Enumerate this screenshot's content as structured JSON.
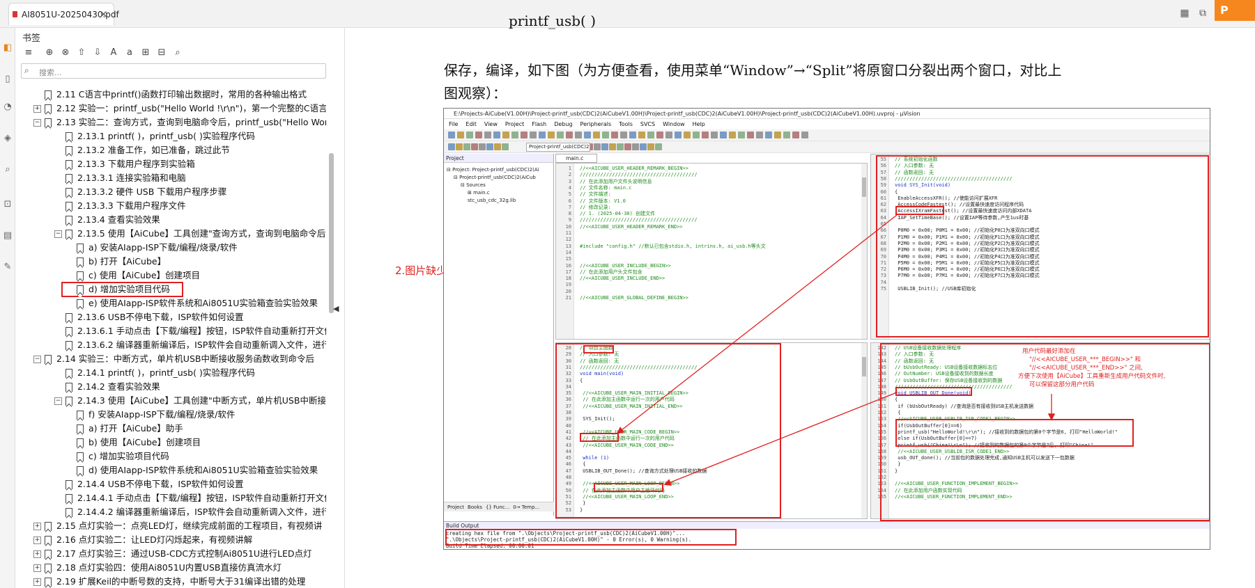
{
  "tab": {
    "filename": "AI8051U-20250430.pdf",
    "close": "×"
  },
  "brand": "P",
  "bookmarks": {
    "title": "书签",
    "search_placeholder": "搜索...",
    "items": [
      {
        "level": 1,
        "exp": "none",
        "text": "2.11 C语言中printf()函数打印输出数据时，常用的各种输出格式"
      },
      {
        "level": 1,
        "exp": "+",
        "text": "2.12 实验一：printf_usb(\"Hello World !\\r\\n\")，第一个完整的C语言程"
      },
      {
        "level": 1,
        "exp": "-",
        "text": "2.13 实验二：查询方式，查询到电脑命令后，printf_usb(\"Hello Wor"
      },
      {
        "level": 2,
        "exp": "none",
        "text": "2.13.1 printf( )，printf_usb( )实验程序代码"
      },
      {
        "level": 2,
        "exp": "none",
        "text": "2.13.2 准备工作，如已准备，跳过此节"
      },
      {
        "level": 2,
        "exp": "none",
        "text": "2.13.3 下载用户程序到实验箱"
      },
      {
        "level": 2,
        "exp": "none",
        "text": "2.13.3.1 连接实验箱和电脑"
      },
      {
        "level": 2,
        "exp": "none",
        "text": "2.13.3.2 硬件 USB 下载用户程序步骤"
      },
      {
        "level": 2,
        "exp": "none",
        "text": "2.13.3.3 下载用户程序文件"
      },
      {
        "level": 2,
        "exp": "none",
        "text": "2.13.4 查看实验效果"
      },
      {
        "level": 2,
        "exp": "-",
        "text": "2.13.5 使用【AiCube】工具创建\"查询方式，查询到电脑命令后,"
      },
      {
        "level": 3,
        "exp": "none",
        "text": "a) 安装AIapp-ISP下载/编程/烧录/软件"
      },
      {
        "level": 3,
        "exp": "none",
        "text": "b) 打开【AiCube】"
      },
      {
        "level": 3,
        "exp": "none",
        "text": "c) 使用【AiCube】创建项目"
      },
      {
        "level": 3,
        "exp": "none",
        "text": "d) 增加实验项目代码",
        "selected": true
      },
      {
        "level": 3,
        "exp": "none",
        "text": "e) 使用AIapp-ISP软件系统和Ai8051U实验箱查验实验效果"
      },
      {
        "level": 2,
        "exp": "none",
        "text": "2.13.6 USB不停电下载，ISP软件如何设置"
      },
      {
        "level": 2,
        "exp": "none",
        "text": "2.13.6.1 手动点击【下载/编程】按钮，ISP软件自动重新打开文件"
      },
      {
        "level": 2,
        "exp": "none",
        "text": "2.13.6.2 编译器重新编译后，ISP软件会自动重新调入文件，进行"
      },
      {
        "level": 1,
        "exp": "-",
        "text": "2.14 实验三：中断方式，单片机USB中断接收服务函数收到命令后"
      },
      {
        "level": 2,
        "exp": "none",
        "text": "2.14.1 printf( )，printf_usb( )实验程序代码"
      },
      {
        "level": 2,
        "exp": "none",
        "text": "2.14.2 查看实验效果"
      },
      {
        "level": 2,
        "exp": "-",
        "text": "2.14.3 使用【AiCube】工具创建\"中断方式，单片机USB中断接收"
      },
      {
        "level": 3,
        "exp": "none",
        "text": "f) 安装AIapp-ISP下载/编程/烧录/软件"
      },
      {
        "level": 3,
        "exp": "none",
        "text": "a) 打开【AiCube】助手"
      },
      {
        "level": 3,
        "exp": "none",
        "text": "b) 使用【AiCube】创建项目"
      },
      {
        "level": 3,
        "exp": "none",
        "text": "c) 增加实验项目代码"
      },
      {
        "level": 3,
        "exp": "none",
        "text": "d) 使用AIapp-ISP软件系统和Ai8051U实验箱查验实验效果"
      },
      {
        "level": 2,
        "exp": "none",
        "text": "2.14.4 USB不停电下载，ISP软件如何设置"
      },
      {
        "level": 2,
        "exp": "none",
        "text": "2.14.4.1 手动点击【下载/编程】按钮，ISP软件自动重新打开文件"
      },
      {
        "level": 2,
        "exp": "none",
        "text": "2.14.4.2 编译器重新编译后，ISP软件会自动重新调入文件，进行"
      },
      {
        "level": 1,
        "exp": "+",
        "text": "2.15 点灯实验一：点亮LED灯，继续完成前面的工程项目，有视频讲"
      },
      {
        "level": 1,
        "exp": "+",
        "text": "2.16 点灯实验二：让LED灯闪烁起来，有视频讲解"
      },
      {
        "level": 1,
        "exp": "+",
        "text": "2.17 点灯实验三：通过USB-CDC方式控制Ai8051U进行LED点灯"
      },
      {
        "level": 1,
        "exp": "+",
        "text": "2.18 点灯实验四：使用Ai8051U内置USB直接仿真流水灯"
      },
      {
        "level": 1,
        "exp": "+",
        "text": "2.19 扩展Keil的中断号数的支持，中断号大于31编译出错的处理"
      }
    ]
  },
  "document": {
    "partial_line": "printf_usb(                  )          ",
    "para_line1": "保存，编译，如下图（为方便查看，使用菜单“Window”→“Split”将原窗口分裂出两个窗口，对比上",
    "para_line2": "图观察）：",
    "annotation": "2.图片缺少 USBLIB_Init();的说明"
  },
  "ide": {
    "title": "E:\\Projects-AiCube(V1.00H)\\Project-printf_usb(CDC)2(AiCubeV1.00H)\\Project-printf_usb(CDC)2(AiCubeV1.00H)\\Project-printf_usb(CDC)2(AiCubeV1.00H).uvproj - µVision",
    "menu": [
      "File",
      "Edit",
      "View",
      "Project",
      "Flash",
      "Debug",
      "Peripherals",
      "Tools",
      "SVCS",
      "Window",
      "Help"
    ],
    "target_combo": "Project-printf_usb(CDC)2(",
    "project_header": "Project",
    "project_tree": [
      {
        "indent": 0,
        "text": "⊟ Project: Project-printf_usb(CDC)2(Ai"
      },
      {
        "indent": 1,
        "text": "⊟ Project-printf_usb(CDC)2(AiCub"
      },
      {
        "indent": 2,
        "text": "⊟ Sources"
      },
      {
        "indent": 3,
        "text": "⊞ main.c"
      },
      {
        "indent": 3,
        "text": "stc_usb_cdc_32g.lib"
      }
    ],
    "project_tabs": [
      "Project",
      "Books",
      "{} Func...",
      "0→ Temp..."
    ],
    "editor_tab": "main.c",
    "pane_tl": [
      {
        "n": "1",
        "t": "//<<AICUBE_USER_HEADER_REMARK_BEGIN>>",
        "c": "cm"
      },
      {
        "n": "2",
        "t": "////////////////////////////////////////",
        "c": "cm"
      },
      {
        "n": "3",
        "t": "// 在此添加用户文件头说明信息",
        "c": "cm"
      },
      {
        "n": "4",
        "t": "// 文件名称: main.c",
        "c": "cm"
      },
      {
        "n": "5",
        "t": "// 文件描述:",
        "c": "cm"
      },
      {
        "n": "6",
        "t": "// 文件版本: V1.0",
        "c": "cm"
      },
      {
        "n": "7",
        "t": "// 修改记录:",
        "c": "cm"
      },
      {
        "n": "8",
        "t": "//   1. (2025-04-30) 创建文件",
        "c": "cm"
      },
      {
        "n": "9",
        "t": "////////////////////////////////////////",
        "c": "cm"
      },
      {
        "n": "10",
        "t": "//<<AICUBE_USER_HEADER_REMARK_END>>",
        "c": "cm"
      },
      {
        "n": "11",
        "t": "",
        "c": ""
      },
      {
        "n": "12",
        "t": "",
        "c": ""
      },
      {
        "n": "13",
        "t": "#include \"config.h\" //默认已包含stdio.h, intrins.h, ai_usb.h等头文",
        "c": "cm"
      },
      {
        "n": "14",
        "t": "",
        "c": ""
      },
      {
        "n": "15",
        "t": "",
        "c": ""
      },
      {
        "n": "16",
        "t": "//<<AICUBE_USER_INCLUDE_BEGIN>>",
        "c": "cm"
      },
      {
        "n": "17",
        "t": "// 在此添加用户头文件包含",
        "c": "cm"
      },
      {
        "n": "18",
        "t": "//<<AICUBE_USER_INCLUDE_END>>",
        "c": "cm"
      },
      {
        "n": "19",
        "t": "",
        "c": ""
      },
      {
        "n": "20",
        "t": "",
        "c": ""
      },
      {
        "n": "21",
        "t": "//<<AICUBE_USER_GLOBAL_DEFINE_BEGIN>>",
        "c": "cm"
      }
    ],
    "pane_tr": [
      {
        "n": "55",
        "t": "// 系统初始化函数",
        "c": "cm"
      },
      {
        "n": "56",
        "t": "// 入口参数: 无",
        "c": "cm"
      },
      {
        "n": "57",
        "t": "// 函数返回: 无",
        "c": "cm"
      },
      {
        "n": "58",
        "t": "////////////////////////////////////////",
        "c": "cm"
      },
      {
        "n": "59",
        "t": "void SYS_Init(void)",
        "c": "kw"
      },
      {
        "n": "60",
        "t": "{",
        "c": ""
      },
      {
        "n": "61",
        "t": "    EnableAccessXFR();                  //使能访问扩展XFR",
        "c": ""
      },
      {
        "n": "62",
        "t": "    AccessCodeFastest();                //设置最快速度访问程序代码",
        "c": ""
      },
      {
        "n": "63",
        "t": "    AccessIXramFastest();               //设置最快速度访问内部XDATA",
        "c": ""
      },
      {
        "n": "64",
        "t": "    IAP_SetTimeBase();                  //设置IAP等待参数,产生1us时基",
        "c": ""
      },
      {
        "n": "65",
        "t": "",
        "c": ""
      },
      {
        "n": "66",
        "t": "    P0M0 = 0x00; P0M1 = 0x00;           //初始化P0口为准双向口模式",
        "c": ""
      },
      {
        "n": "67",
        "t": "    P1M0 = 0x00; P1M1 = 0x00;           //初始化P1口为准双向口模式",
        "c": ""
      },
      {
        "n": "68",
        "t": "    P2M0 = 0x00; P2M1 = 0x00;           //初始化P2口为准双向口模式",
        "c": ""
      },
      {
        "n": "69",
        "t": "    P3M0 = 0x00; P3M1 = 0x00;           //初始化P3口为准双向口模式",
        "c": ""
      },
      {
        "n": "70",
        "t": "    P4M0 = 0x00; P4M1 = 0x00;           //初始化P4口为准双向口模式",
        "c": ""
      },
      {
        "n": "71",
        "t": "    P5M0 = 0x00; P5M1 = 0x00;           //初始化P5口为准双向口模式",
        "c": ""
      },
      {
        "n": "72",
        "t": "    P6M0 = 0x00; P6M1 = 0x00;           //初始化P6口为准双向口模式",
        "c": ""
      },
      {
        "n": "73",
        "t": "    P7M0 = 0x00; P7M1 = 0x00;           //初始化P7口为准双向口模式",
        "c": ""
      },
      {
        "n": "74",
        "t": "",
        "c": ""
      },
      {
        "n": "75",
        "t": "    USBLIB_Init();                      //USB库初始化",
        "c": ""
      }
    ],
    "pane_bl": [
      {
        "n": "28",
        "t": "// 项目主函数",
        "c": "cm"
      },
      {
        "n": "29",
        "t": "// 入口参数: 无",
        "c": "cm"
      },
      {
        "n": "30",
        "t": "// 函数返回: 无",
        "c": "cm"
      },
      {
        "n": "31",
        "t": "////////////////////////////////////////",
        "c": "cm"
      },
      {
        "n": "32",
        "t": "void main(void)",
        "c": "kw"
      },
      {
        "n": "33",
        "t": "{",
        "c": ""
      },
      {
        "n": "34",
        "t": "",
        "c": ""
      },
      {
        "n": "35",
        "t": "    //<<AICUBE_USER_MAIN_INITIAL_BEGIN>>",
        "c": "cm"
      },
      {
        "n": "36",
        "t": "    // 在此添加主函数中运行一次的用户代码",
        "c": "cm"
      },
      {
        "n": "37",
        "t": "    //<<AICUBE_USER_MAIN_INITIAL_END>>",
        "c": "cm"
      },
      {
        "n": "38",
        "t": "",
        "c": ""
      },
      {
        "n": "39",
        "t": "    SYS_Init();",
        "c": ""
      },
      {
        "n": "40",
        "t": "",
        "c": ""
      },
      {
        "n": "41",
        "t": "    //<<AICUBE_USER_MAIN_CODE_BEGIN>>",
        "c": "cm"
      },
      {
        "n": "42",
        "t": "    // 在此添加主函数中运行一次的用户代码",
        "c": "cm"
      },
      {
        "n": "43",
        "t": "    //<<AICUBE_USER_MAIN_CODE_END>>",
        "c": "cm"
      },
      {
        "n": "44",
        "t": "",
        "c": ""
      },
      {
        "n": "45",
        "t": "    while (1)",
        "c": "kw"
      },
      {
        "n": "46",
        "t": "    {",
        "c": ""
      },
      {
        "n": "47",
        "t": "        USBLIB_OUT_Done();              //查询方式处理USB接收的数据",
        "c": ""
      },
      {
        "n": "48",
        "t": "",
        "c": ""
      },
      {
        "n": "49",
        "t": "        //<<AICUBE_USER_MAIN_LOOP_BEGIN>>",
        "c": "cm"
      },
      {
        "n": "50",
        "t": "        // 在此添加主函数中用户主循环代码",
        "c": "cm"
      },
      {
        "n": "51",
        "t": "        //<<AICUBE_USER_MAIN_LOOP_END>>",
        "c": "cm"
      },
      {
        "n": "52",
        "t": "    }",
        "c": ""
      },
      {
        "n": "53",
        "t": "}",
        "c": ""
      }
    ],
    "pane_br": [
      {
        "n": "142",
        "t": "// USB设备接收数据处理程序",
        "c": "cm"
      },
      {
        "n": "143",
        "t": "// 入口参数: 无",
        "c": "cm"
      },
      {
        "n": "144",
        "t": "// 函数返回: 无",
        "c": "cm"
      },
      {
        "n": "145",
        "t": "// bUsbOutReady: USB设备接收数据标志位",
        "c": "cm"
      },
      {
        "n": "146",
        "t": "// OutNumber: USB设备接收到的数据长度",
        "c": "cm"
      },
      {
        "n": "147",
        "t": "// UsbOutBuffer: 保存USB设备接收到的数据",
        "c": "cm"
      },
      {
        "n": "148",
        "t": "////////////////////////////////////////",
        "c": "cm"
      },
      {
        "n": "149",
        "t": "void USBLIB_OUT_Done(void)",
        "c": "kw"
      },
      {
        "n": "150",
        "t": "{",
        "c": ""
      },
      {
        "n": "151",
        "t": "    if (bUsbOutReady)                   //查询是否有接收到USB主机发送数据",
        "c": ""
      },
      {
        "n": "152",
        "t": "    {",
        "c": ""
      },
      {
        "n": "153",
        "t": "        //<<AICUBE_USER_USBLIB_ISR_CODE1_BEGIN>>",
        "c": "cm"
      },
      {
        "n": "154",
        "t": "        if(UsbOutBuffer[0]==6)",
        "c": ""
      },
      {
        "n": "155",
        "t": "            printf_usb(\"HelloWorld!\\r\\n\");  //接收到的数据包的第0个字节是6, 打印\"HelloWorld!\"",
        "c": ""
      },
      {
        "n": "156",
        "t": "        else if(UsbOutBuffer[0]==7)",
        "c": ""
      },
      {
        "n": "157",
        "t": "            printf_usb(\"China!\\r\\n\");       //接收到的数据包的第0个字节是7后, 打印\"China!\"",
        "c": ""
      },
      {
        "n": "158",
        "t": "        //<<AICUBE_USER_USBLIB_ISR_CODE1_END>>",
        "c": "cm"
      },
      {
        "n": "159",
        "t": "        usb_OUT_done();                 //当前包的数据处理完成,通知USB主机可以发送下一包数据",
        "c": ""
      },
      {
        "n": "160",
        "t": "    }",
        "c": ""
      },
      {
        "n": "161",
        "t": "}",
        "c": ""
      },
      {
        "n": "162",
        "t": "",
        "c": ""
      },
      {
        "n": "163",
        "t": "//<<AICUBE_USER_FUNCTION_IMPLEMENT_BEGIN>>",
        "c": "cm"
      },
      {
        "n": "164",
        "t": "// 在此添加用户函数实现代码",
        "c": "cm"
      },
      {
        "n": "165",
        "t": "//<<AICUBE_USER_FUNCTION_IMPLEMENT_END>>",
        "c": "cm"
      }
    ],
    "pane_br_note": [
      "用户代码最好添加在",
      "\"//<<AICUBE_USER_***_BEGIN>>\" 和",
      "\"//<<AICUBE_USER_***_END>>\" 之间,",
      "方便下次使用【AiCube】工具重新生成用户代码文件时,",
      "可以保留这部分用户代码"
    ],
    "build_header": "Build Output",
    "build_lines": [
      "creating hex file from \".\\Objects\\Project-printf_usb(CDC)2(AiCubeV1.00H)\"...",
      "\".\\Objects\\Project-printf_usb(CDC)2(AiCubeV1.00H)\" - 0 Error(s), 0 Warning(s).",
      "Build Time Elapsed:  00:00:01"
    ]
  },
  "colors": {
    "annotation_red": "#e02020",
    "brand_orange": "#f6871f"
  }
}
